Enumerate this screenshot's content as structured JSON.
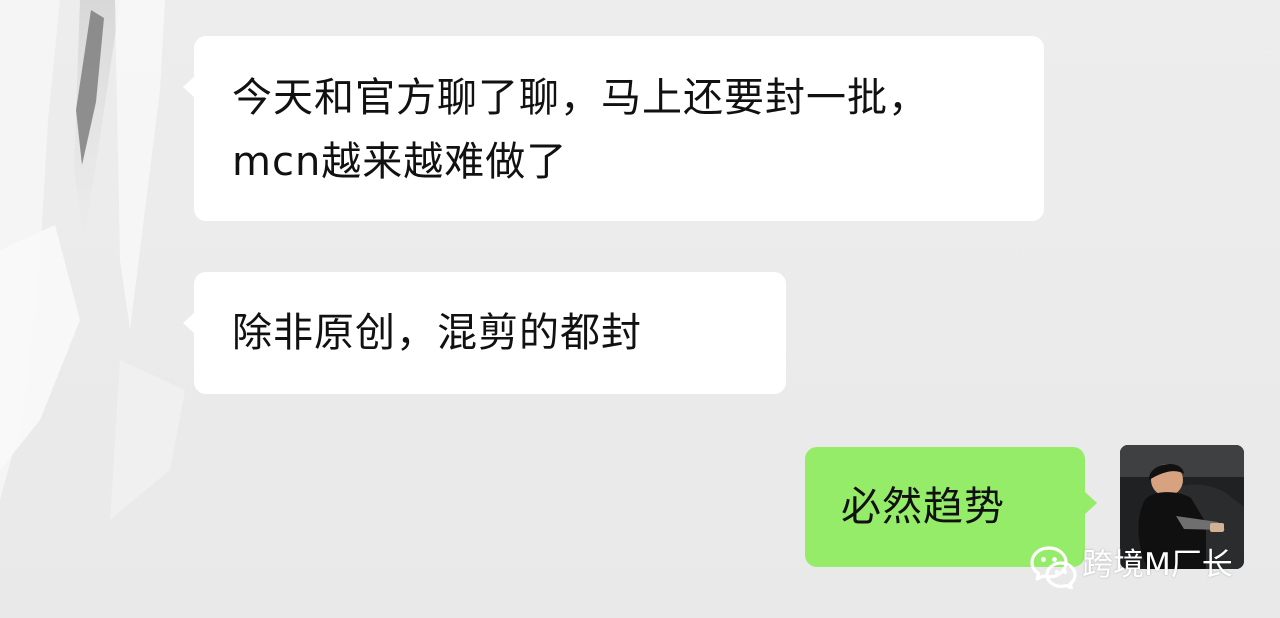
{
  "messages": [
    {
      "id": "msg1",
      "direction": "incoming",
      "text": "今天和官方聊了聊，马上还要封一批，mcn越来越难做了"
    },
    {
      "id": "msg2",
      "direction": "incoming",
      "text": "除非原创，混剪的都封"
    },
    {
      "id": "msg3",
      "direction": "outgoing",
      "text": "必然趋势"
    }
  ],
  "watermark": {
    "icon": "wechat-icon",
    "text": "跨境M厂长"
  },
  "colors": {
    "chat_background": "#ececec",
    "incoming_bubble": "#ffffff",
    "outgoing_bubble": "#95ec69"
  }
}
